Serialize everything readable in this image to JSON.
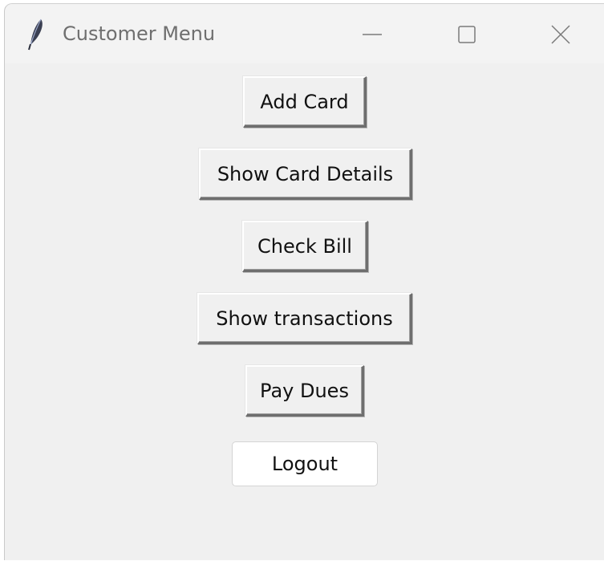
{
  "window": {
    "title": "Customer Menu"
  },
  "icons": {
    "app": "feather-icon",
    "minimize": "minimize-icon",
    "maximize": "maximize-icon",
    "close": "close-icon"
  },
  "menu": {
    "add_card": "Add Card",
    "show_card_details": "Show Card Details",
    "check_bill": "Check Bill",
    "show_transactions": "Show transactions",
    "pay_dues": "Pay Dues",
    "logout": "Logout"
  },
  "colors": {
    "window_background": "#f0f0f0",
    "title_text": "#6f6f6f",
    "logout_background": "#ffffff"
  }
}
